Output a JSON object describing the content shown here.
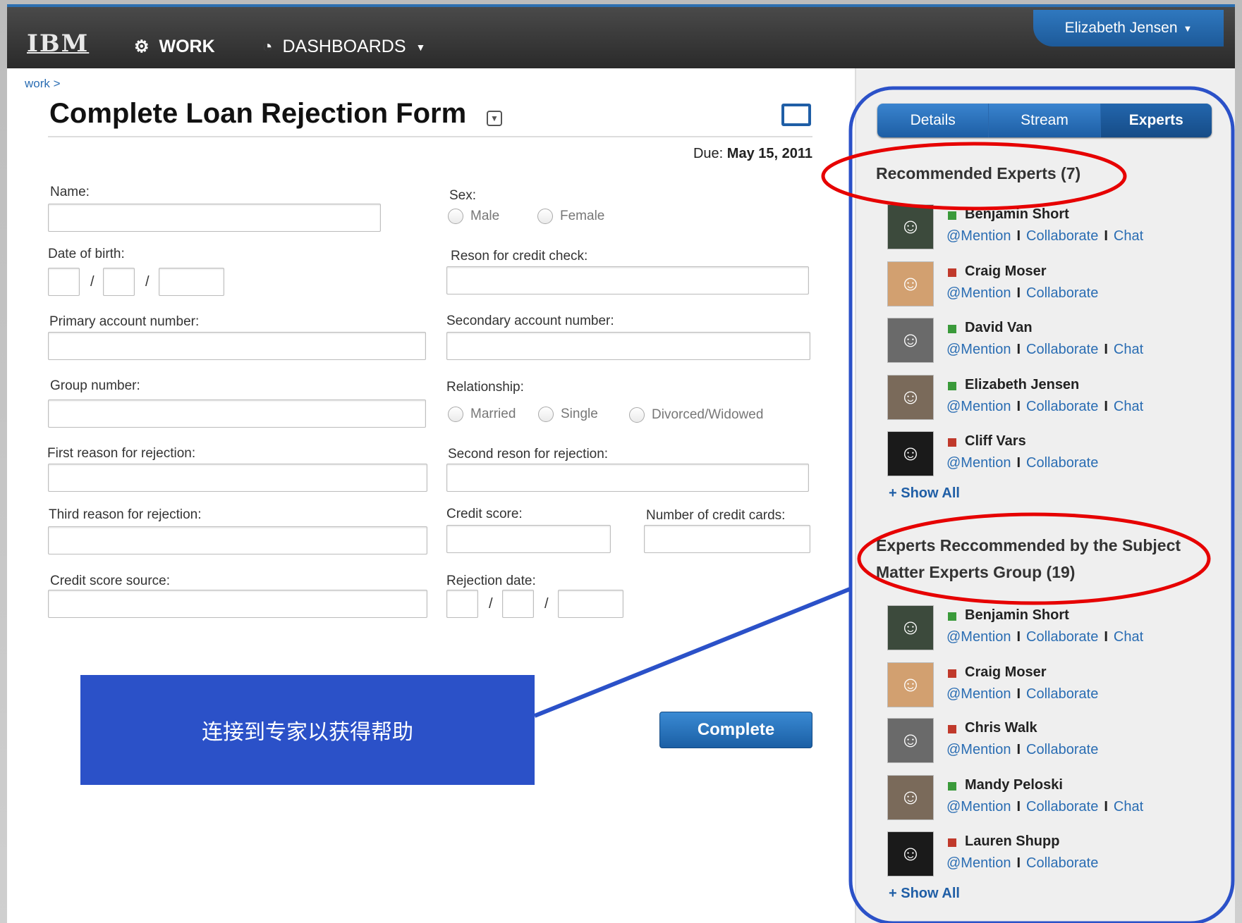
{
  "header": {
    "logo": "IBM",
    "nav_work": "WORK",
    "nav_dashboards": "DASHBOARDS",
    "user": "Elizabeth Jensen"
  },
  "main": {
    "breadcrumb": "work  >",
    "title": "Complete Loan Rejection Form",
    "due_label": "Due:",
    "due_date": "May 15, 2011",
    "fields": {
      "name": "Name:",
      "sex": "Sex:",
      "male": "Male",
      "female": "Female",
      "dob": "Date of birth:",
      "reason_credit": "Reson for credit check:",
      "primary_acct": "Primary account number:",
      "secondary_acct": "Secondary account number:",
      "group_number": "Group number:",
      "relationship": "Relationship:",
      "married": "Married",
      "single": "Single",
      "divorced": "Divorced/Widowed",
      "first_reason": "First reason for rejection:",
      "second_reason": "Second reson for rejection:",
      "third_reason": "Third reason for rejection:",
      "credit_score": "Credit score:",
      "num_cards": "Number of credit cards:",
      "credit_source": "Credit score source:",
      "rejection_date": "Rejection date:",
      "slash": "/"
    },
    "callout": "连接到专家以获得帮助",
    "complete_button": "Complete"
  },
  "sidebar": {
    "tabs": [
      "Details",
      "Stream",
      "Experts"
    ],
    "recommended_title": "Recommended Experts (7)",
    "sme_title_line1": "Experts Reccommended by the Subject",
    "sme_title_line2": "Matter Experts Group (19)",
    "mention": "@Mention",
    "collaborate": "Collaborate",
    "chat": "Chat",
    "separator": "I",
    "show_all": "+ Show All",
    "recommended": [
      {
        "name": "Benjamin Short",
        "status": "#3a9a3a",
        "chat": true
      },
      {
        "name": "Craig Moser",
        "status": "#c0392b",
        "chat": false
      },
      {
        "name": "David Van",
        "status": "#3a9a3a",
        "chat": true
      },
      {
        "name": "Elizabeth Jensen",
        "status": "#3a9a3a",
        "chat": true
      },
      {
        "name": "Cliff Vars",
        "status": "#c0392b",
        "chat": false
      }
    ],
    "sme": [
      {
        "name": "Benjamin Short",
        "status": "#3a9a3a",
        "chat": true
      },
      {
        "name": "Craig Moser",
        "status": "#c0392b",
        "chat": false
      },
      {
        "name": "Chris Walk",
        "status": "#c0392b",
        "chat": false
      },
      {
        "name": "Mandy Peloski",
        "status": "#3a9a3a",
        "chat": true
      },
      {
        "name": "Lauren Shupp",
        "status": "#c0392b",
        "chat": false
      }
    ]
  }
}
